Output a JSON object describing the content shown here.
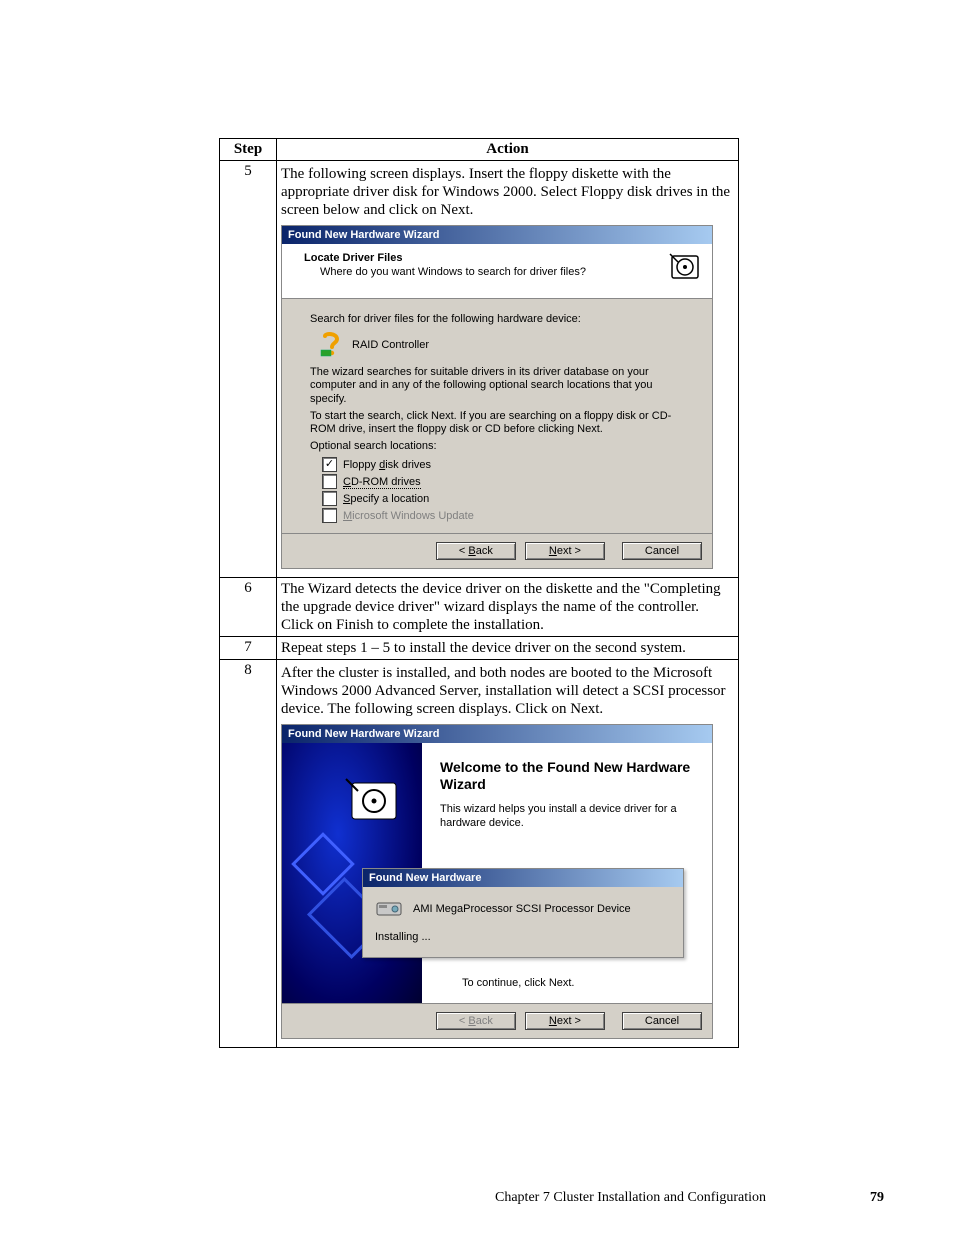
{
  "table": {
    "header_step": "Step",
    "header_action": "Action"
  },
  "row5": {
    "step": "5",
    "text": "The following screen displays. Insert the floppy diskette with the appropriate driver disk for Windows 2000. Select Floppy disk drives in the screen below and click on Next.",
    "wizard_title": "Found New Hardware Wizard",
    "hdr_title": "Locate Driver Files",
    "hdr_sub": "Where do you want Windows to search for driver files?",
    "search_line": "Search for driver files for the following hardware device:",
    "device_name": "RAID Controller",
    "para1": "The wizard searches for suitable drivers in its driver database on your computer and in any of the following optional search locations that you specify.",
    "para2": "To start the search, click Next. If you are searching on a floppy disk or CD-ROM drive, insert the floppy disk or CD before clicking Next.",
    "opt_label": "Optional search locations:",
    "cb_floppy_pre": "Floppy ",
    "cb_floppy_u": "d",
    "cb_floppy_post": "isk drives",
    "cb_cd_u": "C",
    "cb_cd_post": "D-ROM drives",
    "cb_spec_u": "S",
    "cb_spec_post": "pecify a location",
    "cb_winupd_u": "M",
    "cb_winupd_post": "icrosoft Windows Update",
    "btn_back_pre": "< ",
    "btn_back_u": "B",
    "btn_back_post": "ack",
    "btn_next_u": "N",
    "btn_next_post": "ext >",
    "btn_cancel": "Cancel"
  },
  "row6": {
    "step": "6",
    "text": "The Wizard detects the device driver on the diskette and the \"Completing the upgrade device driver\" wizard displays the name of the controller. Click on Finish to complete the installation."
  },
  "row7": {
    "step": "7",
    "text": "Repeat steps 1 – 5 to install the device driver on the second system."
  },
  "row8": {
    "step": "8",
    "text": "After the cluster is installed, and both nodes are booted to the Microsoft Windows 2000 Advanced Server, installation will detect a SCSI processor device. The following screen displays. Click on Next.",
    "wizard_title": "Found New Hardware Wizard",
    "welcome_title": "Welcome to the Found New Hardware Wizard",
    "welcome_text": "This wizard helps you install a device driver for a hardware device.",
    "continue": "To continue, click Next.",
    "popup_title": "Found New Hardware",
    "popup_device": "AMI MegaProcessor SCSI Processor Device",
    "popup_install": "Installing ...",
    "btn_back_pre": "< ",
    "btn_back_u": "B",
    "btn_back_post": "ack",
    "btn_next_u": "N",
    "btn_next_post": "ext >",
    "btn_cancel": "Cancel"
  },
  "footer": {
    "text": "Chapter 7 Cluster Installation and Configuration",
    "page": "79"
  }
}
